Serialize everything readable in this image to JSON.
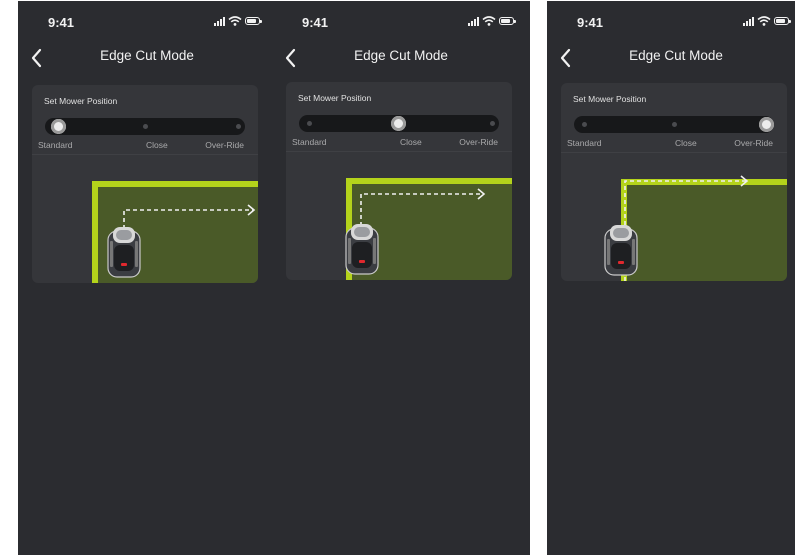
{
  "status": {
    "time": "9:41"
  },
  "header": {
    "title": "Edge Cut Mode"
  },
  "card": {
    "label": "Set Mower Position"
  },
  "options": [
    "Standard",
    "Close",
    "Over-Ride"
  ],
  "screens": [
    {
      "selected": "Standard"
    },
    {
      "selected": "Close"
    },
    {
      "selected": "Over-Ride"
    }
  ],
  "colors": {
    "background": "#2b2c30",
    "card": "#35363a",
    "lawn": "#4a5a28",
    "edge": "#b4d31b"
  },
  "icons": [
    "back-chevron-icon",
    "signal-icon",
    "wifi-icon",
    "battery-icon",
    "mower-icon"
  ]
}
